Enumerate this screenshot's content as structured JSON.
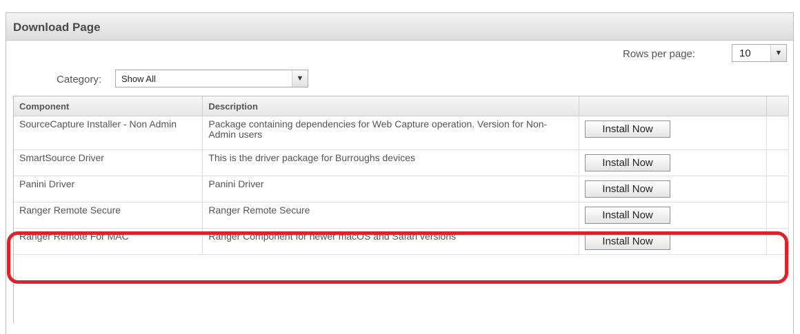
{
  "header": {
    "title": "Download Page"
  },
  "pagination": {
    "rows_label": "Rows per page:",
    "rows_value": "10"
  },
  "filter": {
    "category_label": "Category:",
    "category_value": "Show All"
  },
  "table": {
    "columns": [
      "Component",
      "Description",
      ""
    ],
    "rows": [
      {
        "component": "SourceCapture Installer - Non Admin",
        "description": "Package containing dependencies for Web Capture operation. Version for Non-Admin users",
        "action": "Install Now"
      },
      {
        "component": "SmartSource Driver",
        "description": "This is the driver package for Burroughs devices",
        "action": "Install Now"
      },
      {
        "component": "Panini Driver",
        "description": "Panini Driver",
        "action": "Install Now"
      },
      {
        "component": "Ranger Remote Secure",
        "description": "Ranger Remote Secure",
        "action": "Install Now"
      },
      {
        "component": "Ranger Remote For MAC",
        "description": "Ranger Component for newer macOS and Safari versions",
        "action": "Install Now"
      }
    ]
  },
  "annotation": {
    "color": "#e0202a"
  }
}
